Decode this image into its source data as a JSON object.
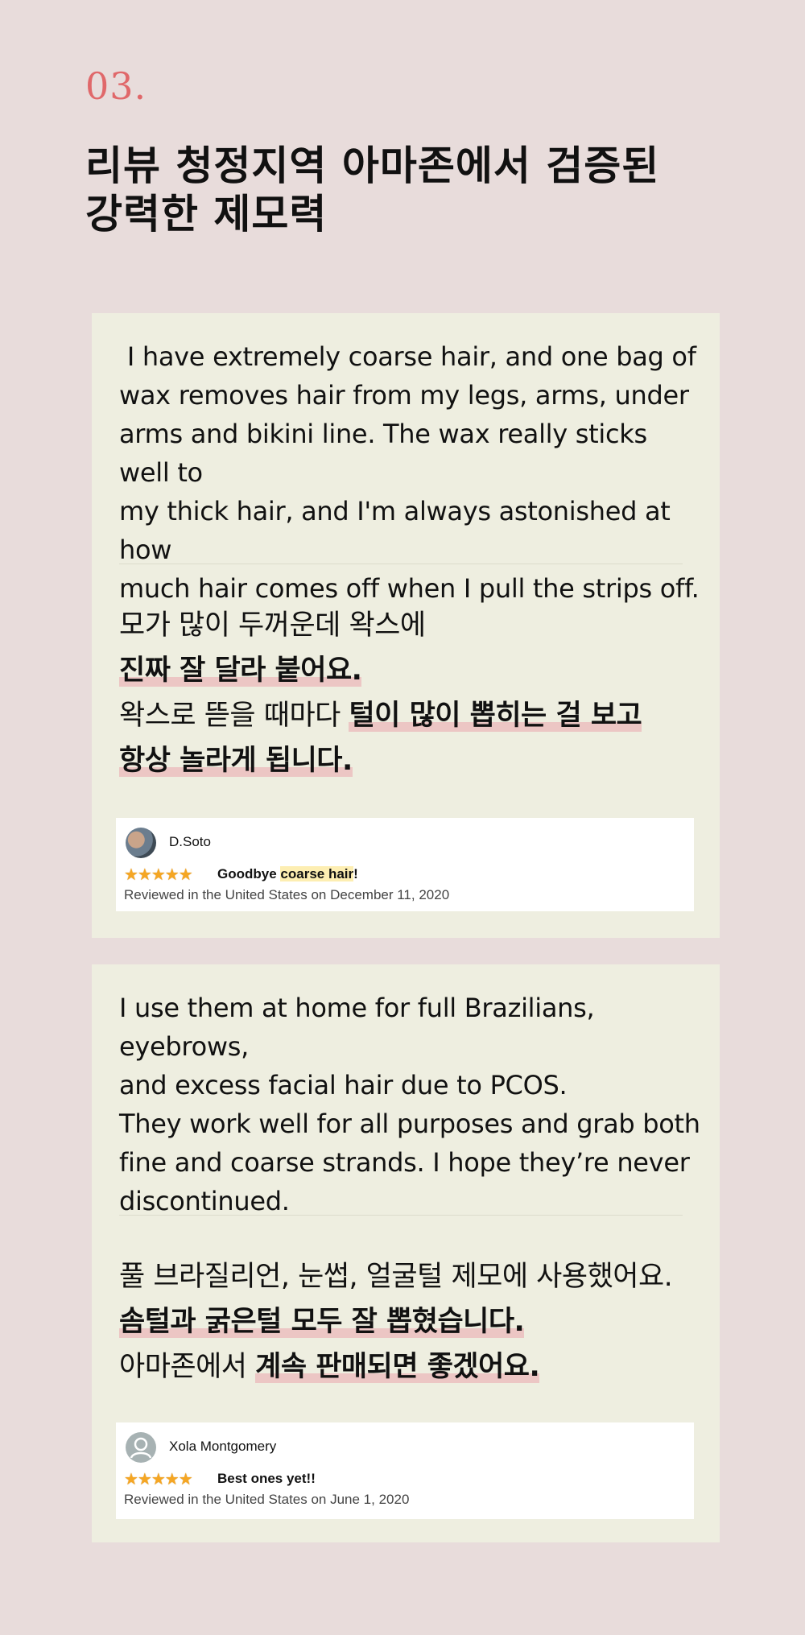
{
  "section": {
    "number": "03.",
    "title_lines": [
      "리뷰 청정지역 아마존에서 검증된",
      "강력한 제모력"
    ]
  },
  "reviews": [
    {
      "english_lines": [
        " I have extremely coarse hair, and one bag of",
        "wax removes hair from my legs, arms, under",
        "arms and bikini line. The wax really sticks well to",
        "my thick hair, and I'm always astonished at how",
        "much hair comes off when I pull the strips off."
      ],
      "korean": {
        "l1": "모가 많이 두꺼운데 왁스에",
        "l2": "진짜 잘 달라 붙어요.",
        "l3_plain": "왁스로 뜯을 때마다 ",
        "l3_bold": "털이 많이 뽑히는 걸 보고",
        "l4": "항상 놀라게 됩니다."
      },
      "reviewer": {
        "name": "D.Soto",
        "avatar_icon": "user-photo-avatar-icon",
        "stars": "★★★★★",
        "rating": 5,
        "title_pre": "Goodbye ",
        "title_mark": "coarse hair",
        "title_post": "!",
        "meta": "Reviewed in the United States on December 11, 2020"
      }
    },
    {
      "english_lines": [
        "I use them at home for full Brazilians, eyebrows,",
        "and excess facial hair due to PCOS.",
        "They work well for all purposes and grab both",
        "fine and coarse strands. I hope they’re never",
        "discontinued."
      ],
      "korean": {
        "l1": "풀 브라질리언, 눈썹, 얼굴털 제모에 사용했어요.",
        "l2": "솜털과 굵은털 모두 잘 뽑혔습니다.",
        "l3_plain": "아마존에서 ",
        "l3_bold": "계속 판매되면 좋겠어요."
      },
      "reviewer": {
        "name": "Xola Montgomery",
        "avatar_icon": "generic-user-avatar-icon",
        "stars": "★★★★★",
        "rating": 5,
        "title": "Best ones yet!!",
        "meta": "Reviewed in the United States on June 1, 2020"
      }
    }
  ],
  "colors": {
    "page_bg": "#e8dcdb",
    "card_bg": "#eeeee0",
    "accent_number": "#e0686a",
    "highlight": "#ecc6c4",
    "star": "#f5a623"
  }
}
